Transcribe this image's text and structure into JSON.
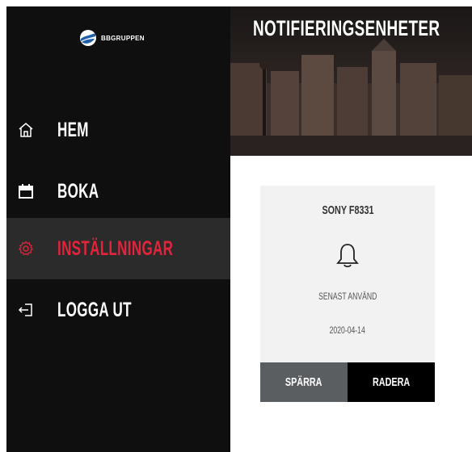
{
  "sidebar": {
    "logo_text": "BBGRUPPEN",
    "items": [
      {
        "label": "HEM",
        "icon": "home-icon"
      },
      {
        "label": "BOKA",
        "icon": "calendar-icon"
      },
      {
        "label": "INSTÄLLNINGAR",
        "icon": "gear-icon",
        "active": true
      },
      {
        "label": "LOGGA UT",
        "icon": "logout-icon"
      }
    ]
  },
  "header": {
    "title": "NOTIFIERINGSENHETER"
  },
  "device": {
    "name": "SONY F8331",
    "icon": "bell-icon",
    "last_used_label": "SENAST ANVÄND",
    "last_used_date": "2020-04-14",
    "block_label": "SPÄRRA",
    "delete_label": "RADERA"
  },
  "colors": {
    "sidebar_bg": "#0f0f0f",
    "active_bg": "#2b2b2b",
    "accent": "#e3243b",
    "card_bg": "#f2f2f2"
  }
}
